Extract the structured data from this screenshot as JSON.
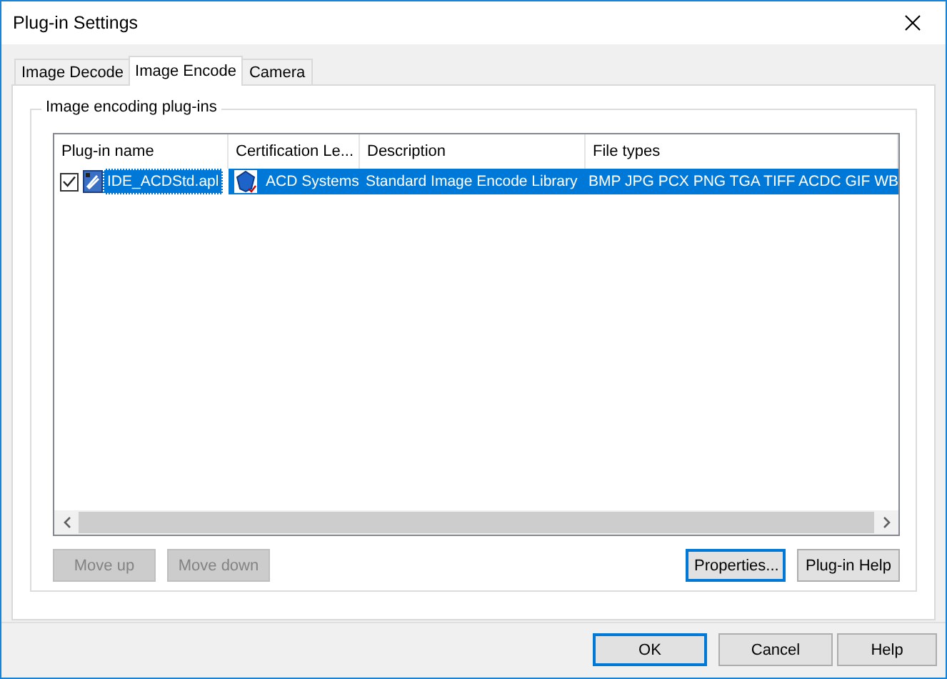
{
  "window": {
    "title": "Plug-in Settings"
  },
  "tabs": [
    {
      "label": "Image Decode",
      "selected": false
    },
    {
      "label": "Image Encode",
      "selected": true
    },
    {
      "label": "Camera",
      "selected": false
    }
  ],
  "group": {
    "title": "Image encoding plug-ins"
  },
  "list": {
    "columns": [
      "Plug-in name",
      "Certification Le...",
      "Description",
      "File types"
    ],
    "rows": [
      {
        "checked": true,
        "selected": true,
        "name": "IDE_ACDStd.apl",
        "certification": "ACD Systems",
        "description": "Standard Image Encode Library",
        "file_types": "BMP JPG PCX PNG TGA TIFF ACDC GIF WB"
      }
    ]
  },
  "list_buttons": [
    {
      "label": "Move up",
      "disabled": true,
      "default": false
    },
    {
      "label": "Move down",
      "disabled": true,
      "default": false
    },
    {
      "label": "Properties...",
      "disabled": false,
      "default": true
    },
    {
      "label": "Plug-in Help",
      "disabled": false,
      "default": false
    }
  ],
  "footer_buttons": [
    {
      "label": "OK",
      "disabled": false,
      "default": true
    },
    {
      "label": "Cancel",
      "disabled": false,
      "default": false
    },
    {
      "label": "Help",
      "disabled": false,
      "default": false
    }
  ]
}
